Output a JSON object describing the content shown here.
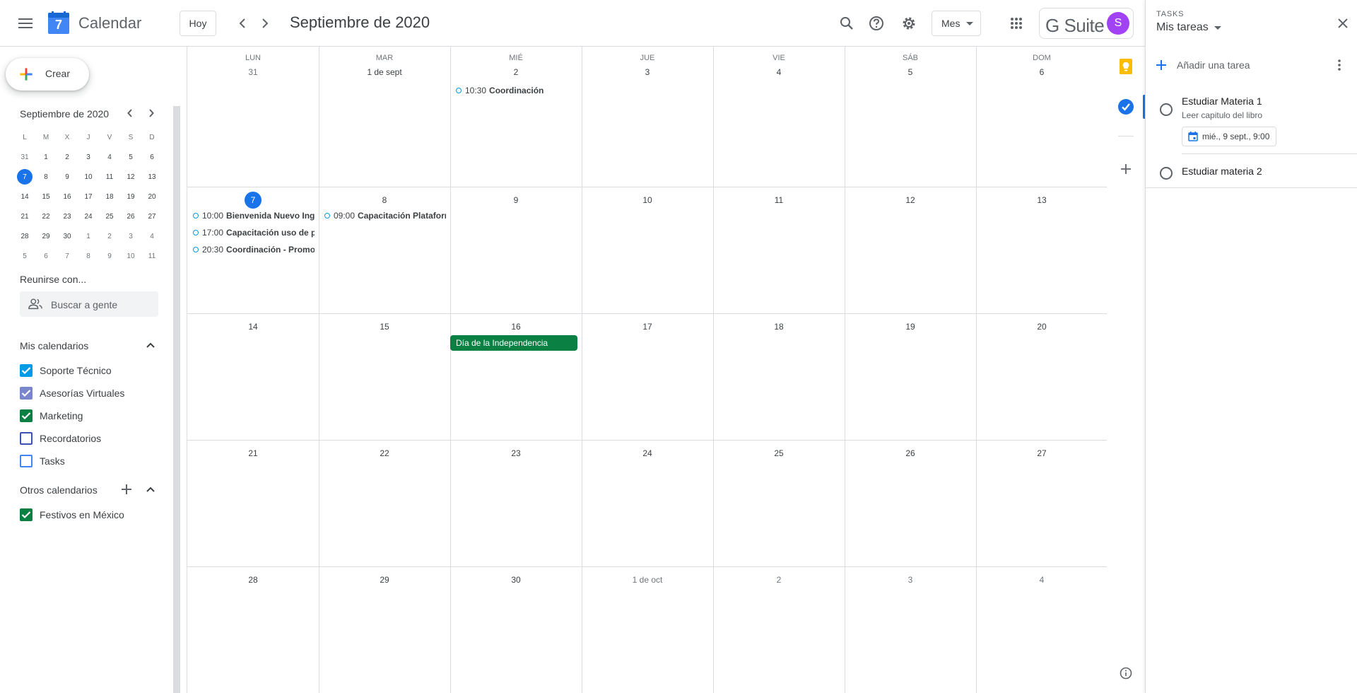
{
  "header": {
    "app_name": "Calendar",
    "logo_day": "7",
    "today_label": "Hoy",
    "current_month": "Septiembre de 2020",
    "view_label": "Mes",
    "suite_label": "G Suite",
    "avatar_initial": "S"
  },
  "sidebar": {
    "create_label": "Crear",
    "mini_calendar": {
      "title": "Septiembre de 2020",
      "weekday_headers": [
        "L",
        "M",
        "X",
        "J",
        "V",
        "S",
        "D"
      ],
      "selected_day": "7",
      "weeks": [
        [
          "31",
          "1",
          "2",
          "3",
          "4",
          "5",
          "6"
        ],
        [
          "7",
          "8",
          "9",
          "10",
          "11",
          "12",
          "13"
        ],
        [
          "14",
          "15",
          "16",
          "17",
          "18",
          "19",
          "20"
        ],
        [
          "21",
          "22",
          "23",
          "24",
          "25",
          "26",
          "27"
        ],
        [
          "28",
          "29",
          "30",
          "1",
          "2",
          "3",
          "4"
        ],
        [
          "5",
          "6",
          "7",
          "8",
          "9",
          "10",
          "11"
        ]
      ]
    },
    "meet_title": "Reunirse con...",
    "people_search_placeholder": "Buscar a gente",
    "my_calendars_title": "Mis calendarios",
    "my_calendars": [
      {
        "label": "Soporte Técnico",
        "checked": true,
        "color": "#039be5"
      },
      {
        "label": "Asesorías Virtuales",
        "checked": true,
        "color": "#7986cb"
      },
      {
        "label": "Marketing",
        "checked": true,
        "color": "#0b8043"
      },
      {
        "label": "Recordatorios",
        "checked": false,
        "color": "#3f51b5"
      },
      {
        "label": "Tasks",
        "checked": false,
        "color": "#4285f4"
      }
    ],
    "other_calendars_title": "Otros calendarios",
    "other_calendars": [
      {
        "label": "Festivos en México",
        "checked": true,
        "color": "#0b8043"
      }
    ]
  },
  "calendar": {
    "weekdays": [
      "LUN",
      "MAR",
      "MIÉ",
      "JUE",
      "VIE",
      "SÁB",
      "DOM"
    ],
    "today": "7",
    "weeks": [
      [
        "31",
        "1 de sept",
        "2",
        "3",
        "4",
        "5",
        "6"
      ],
      [
        "7",
        "8",
        "9",
        "10",
        "11",
        "12",
        "13"
      ],
      [
        "14",
        "15",
        "16",
        "17",
        "18",
        "19",
        "20"
      ],
      [
        "21",
        "22",
        "23",
        "24",
        "25",
        "26",
        "27"
      ],
      [
        "28",
        "29",
        "30",
        "1 de oct",
        "2",
        "3",
        "4"
      ]
    ],
    "events": [
      {
        "time": "10:30",
        "title": "Coordinación"
      },
      {
        "time": "10:00",
        "title": "Bienvenida Nuevo Ingreso"
      },
      {
        "time": "17:00",
        "title": "Capacitación uso de plataforma"
      },
      {
        "time": "20:30",
        "title": "Coordinación - Promoción"
      },
      {
        "time": "09:00",
        "title": "Capacitación Plataforma"
      }
    ],
    "allday_event": "Día de la Independencia",
    "allday_color": "#0b8043"
  },
  "rail": {
    "icons": [
      "keep-icon",
      "tasks-icon",
      "add-icon",
      "info-icon"
    ]
  },
  "tasks": {
    "kicker": "TASKS",
    "list_name": "Mis tareas",
    "add_label": "Añadir una tarea",
    "items": [
      {
        "title": "Estudiar Materia 1",
        "note": "Leer capitulo del libro",
        "due": "mié., 9 sept., 9:00"
      },
      {
        "title": "Estudiar materia 2"
      }
    ]
  }
}
